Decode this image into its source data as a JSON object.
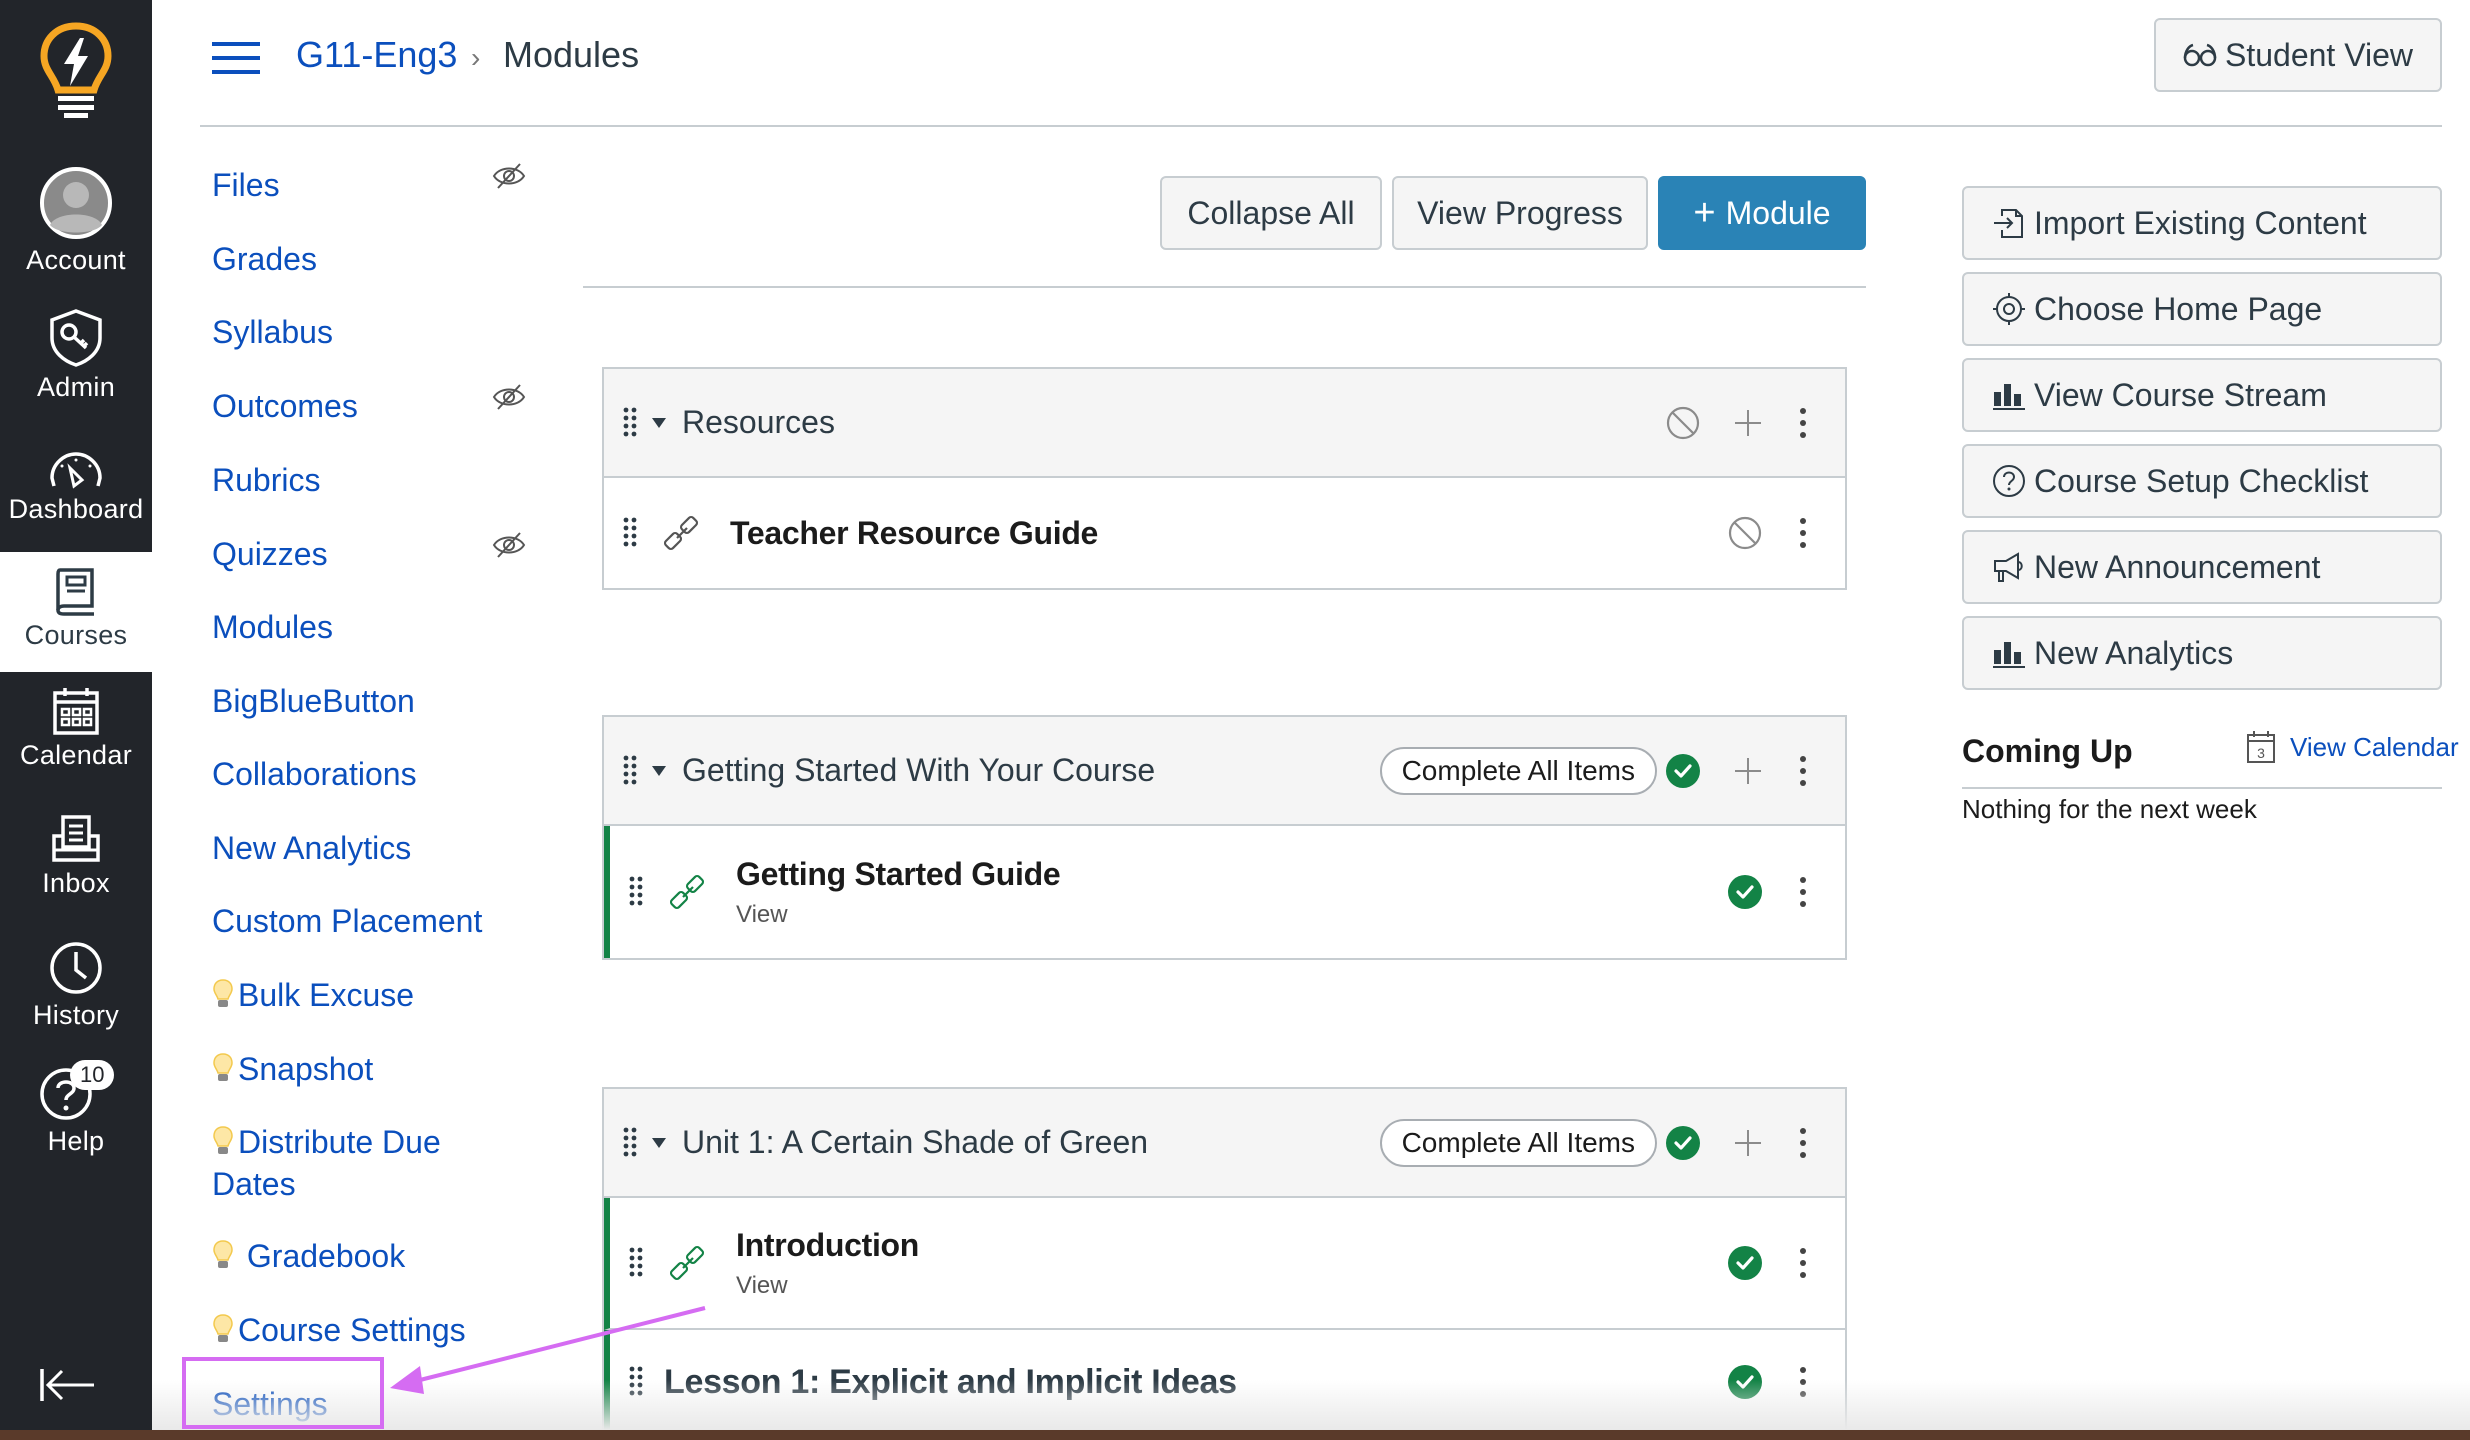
{
  "global_nav": {
    "items": [
      {
        "label": "Account",
        "icon": "avatar-icon"
      },
      {
        "label": "Admin",
        "icon": "shield-key-icon"
      },
      {
        "label": "Dashboard",
        "icon": "dashboard-gauge-icon"
      },
      {
        "label": "Courses",
        "icon": "book-icon",
        "active": true
      },
      {
        "label": "Calendar",
        "icon": "calendar-icon"
      },
      {
        "label": "Inbox",
        "icon": "inbox-icon"
      },
      {
        "label": "History",
        "icon": "clock-icon"
      },
      {
        "label": "Help",
        "icon": "help-icon",
        "badge": "10"
      }
    ]
  },
  "header": {
    "course": "G11-Eng3",
    "separator": "›",
    "current": "Modules",
    "student_view": "Student View"
  },
  "course_nav": {
    "items": [
      {
        "label": "Files",
        "hidden": true
      },
      {
        "label": "Grades"
      },
      {
        "label": "Syllabus"
      },
      {
        "label": "Outcomes",
        "hidden": true
      },
      {
        "label": "Rubrics"
      },
      {
        "label": "Quizzes",
        "hidden": true
      },
      {
        "label": "Modules"
      },
      {
        "label": "BigBlueButton"
      },
      {
        "label": "Collaborations"
      },
      {
        "label": "New Analytics"
      },
      {
        "label": "Custom Placement"
      },
      {
        "label": "Bulk Excuse",
        "bulb": true
      },
      {
        "label": "Snapshot",
        "bulb": true
      },
      {
        "label": "Distribute Due",
        "label2": "Dates",
        "bulb": true
      },
      {
        "label": "Gradebook",
        "bulb": true
      },
      {
        "label": "Course Settings",
        "bulb": true
      },
      {
        "label": "Settings"
      }
    ]
  },
  "toolbar": {
    "collapse_all": "Collapse All",
    "view_progress": "View Progress",
    "add_module": "Module",
    "add_module_icon": "+"
  },
  "modules": [
    {
      "title": "Resources",
      "published": false,
      "items": [
        {
          "title": "Teacher Resource Guide",
          "type": "external-link",
          "published": false
        }
      ]
    },
    {
      "title": "Getting Started With Your Course",
      "requirement": "Complete All Items",
      "published": true,
      "items": [
        {
          "title": "Getting Started Guide",
          "subtitle": "View",
          "type": "external-link",
          "published": true
        }
      ]
    },
    {
      "title": "Unit 1: A Certain Shade of Green",
      "requirement": "Complete All Items",
      "published": true,
      "items": [
        {
          "title": "Introduction",
          "subtitle": "View",
          "type": "external-link",
          "published": true
        },
        {
          "title": "Lesson 1: Explicit and Implicit Ideas",
          "type": "subheader",
          "published": true
        }
      ]
    }
  ],
  "sidebar_actions": [
    {
      "label": "Import Existing Content",
      "icon": "import-icon"
    },
    {
      "label": "Choose Home Page",
      "icon": "target-icon"
    },
    {
      "label": "View Course Stream",
      "icon": "bar-chart-icon"
    },
    {
      "label": "Course Setup Checklist",
      "icon": "question-circle-icon"
    },
    {
      "label": "New Announcement",
      "icon": "megaphone-icon"
    },
    {
      "label": "New Analytics",
      "icon": "bar-chart-icon"
    }
  ],
  "coming_up": {
    "title": "Coming Up",
    "view_calendar": "View Calendar",
    "calendar_day": "3",
    "empty": "Nothing for the next week"
  },
  "colors": {
    "brand_blue": "#0b4fbd",
    "primary_button": "#2a83b6",
    "success_green": "#138346",
    "nav_bg": "#22252a",
    "annotation": "#d56cf2",
    "logo_orange": "#f6a623"
  }
}
